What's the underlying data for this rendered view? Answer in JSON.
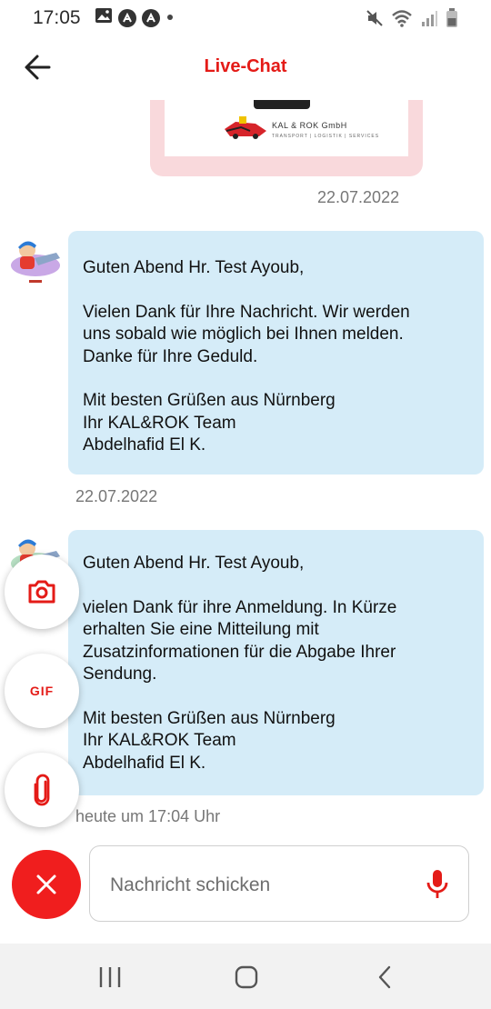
{
  "status_bar": {
    "time": "17:05",
    "left_icons": [
      "image-icon",
      "notification-badge-icon",
      "notification-badge-icon",
      "dot-icon"
    ],
    "right_icons": [
      "mute-icon",
      "wifi-icon",
      "signal-icon",
      "battery-icon"
    ]
  },
  "app_bar": {
    "title": "Live-Chat",
    "back_icon": "arrow-left-icon"
  },
  "image_message": {
    "logo_text": "KAL & ROK GmbH",
    "logo_subtext": "TRANSPORT | LOGISTIK | SERVICES",
    "timestamp": "22.07.2022"
  },
  "messages": [
    {
      "greeting": "Guten Abend Hr. Test Ayoub,",
      "body": [
        "Vielen Dank für Ihre Nachricht. Wir werden",
        "uns sobald wie möglich bei Ihnen melden.",
        "Danke für Ihre Geduld."
      ],
      "closing": [
        "Mit besten Grüßen aus Nürnberg",
        "Ihr KAL&ROK Team",
        "Abdelhafid El K."
      ],
      "timestamp": "22.07.2022"
    },
    {
      "greeting": "Guten Abend Hr. Test Ayoub,",
      "body": [
        "vielen Dank für ihre Anmeldung. In Kürze",
        "erhalten Sie eine Mitteilung mit",
        "Zusatzinformationen für die Abgabe Ihrer",
        "Sendung."
      ],
      "closing": [
        "Mit besten Grüßen aus Nürnberg",
        "Ihr KAL&ROK Team",
        "Abdelhafid El K."
      ],
      "timestamp": "heute um 17:04 Uhr"
    }
  ],
  "attachment_menu": {
    "camera_icon": "camera-icon",
    "gif_label": "GIF",
    "attach_icon": "paperclip-icon",
    "close_icon": "close-icon"
  },
  "composer": {
    "placeholder": "Nachricht schicken",
    "value": "",
    "mic_icon": "microphone-icon"
  },
  "nav_bar": {
    "icons": [
      "recent-apps-icon",
      "home-icon",
      "back-icon"
    ]
  },
  "colors": {
    "accent": "#e41b17",
    "bubble": "#d5ecf8",
    "image_card": "#f9d9dc",
    "close_fab": "#f01e1e"
  }
}
